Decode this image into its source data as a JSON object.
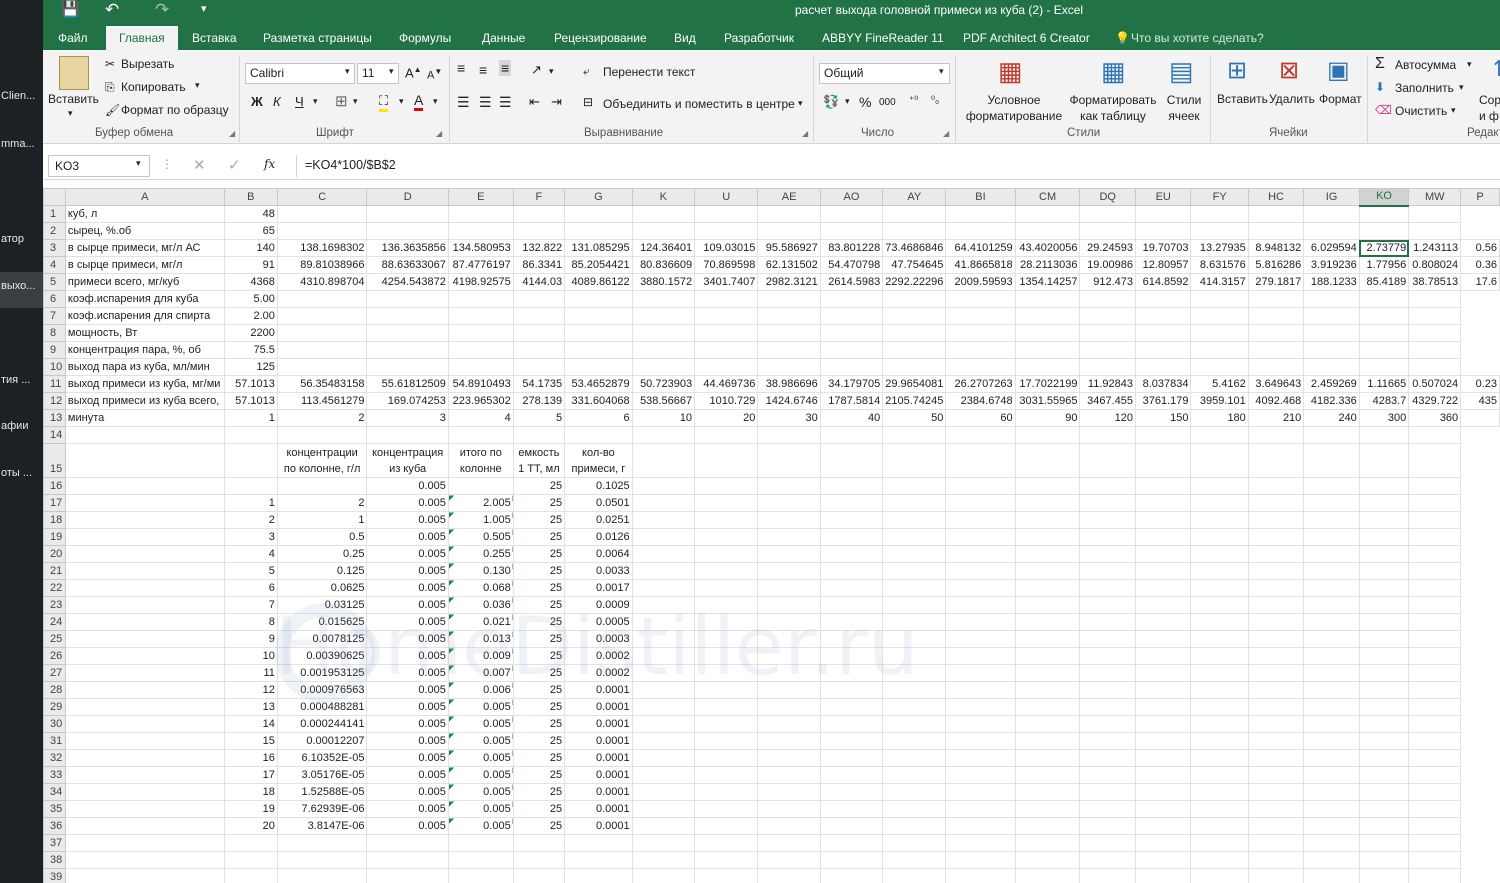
{
  "app": {
    "window_title": "расчет выхода головной примеси из куба (2) - Excel",
    "quick_access": {
      "save": "💾",
      "undo": "↶",
      "redo": "↷",
      "more": "▾"
    }
  },
  "left_panel": [
    "Clien...",
    "mma...",
    "атор",
    "выхо...",
    "тия ...",
    "афии",
    "оты ..."
  ],
  "tabs": [
    "Файл",
    "Главная",
    "Вставка",
    "Разметка страницы",
    "Формулы",
    "Данные",
    "Рецензирование",
    "Вид",
    "Разработчик",
    "ABBYY FineReader 11",
    "PDF Architect 6 Creator",
    "Что вы хотите сделать?"
  ],
  "ribbon": {
    "clipboard": {
      "paste": "Вставить",
      "cut": "Вырезать",
      "copy": "Копировать",
      "format_painter": "Формат по образцу",
      "group": "Буфер обмена"
    },
    "font": {
      "name": "Calibri",
      "size": "11",
      "bold": "Ж",
      "italic": "К",
      "underline": "Ч",
      "group": "Шрифт"
    },
    "alignment": {
      "wrap": "Перенести текст",
      "merge": "Объединить и поместить в центре",
      "group": "Выравнивание"
    },
    "number": {
      "format": "Общий",
      "group": "Число"
    },
    "styles": {
      "conditional": "Условное форматирование",
      "as_table": "Форматировать как таблицу",
      "cell_styles": "Стили ячеек",
      "group": "Стили"
    },
    "cells": {
      "insert": "Вставить",
      "delete": "Удалить",
      "format": "Формат",
      "group": "Ячейки"
    },
    "editing": {
      "autosum": "Автосумма",
      "fill": "Заполнить",
      "clear": "Очистить",
      "sort": "Сорт",
      "sort2": "и ф",
      "group": "Редактир"
    }
  },
  "formula_bar": {
    "name_box": "KO3",
    "formula": "=KO4*100/$B$2",
    "fx": "fx"
  },
  "columns": [
    "",
    "A",
    "B",
    "C",
    "D",
    "E",
    "F",
    "G",
    "K",
    "U",
    "AE",
    "AO",
    "AY",
    "BI",
    "CM",
    "DQ",
    "EU",
    "FY",
    "HC",
    "IG",
    "KO",
    "MW",
    "P"
  ],
  "rows": [
    {
      "n": "1",
      "cells": [
        "куб, л",
        "48",
        "",
        "",
        "",
        "",
        "",
        "",
        "",
        "",
        "",
        "",
        "",
        "",
        "",
        "",
        "",
        "",
        "",
        "",
        ""
      ]
    },
    {
      "n": "2",
      "cells": [
        "сырец, %.об",
        "65",
        "",
        "",
        "",
        "",
        "",
        "",
        "",
        "",
        "",
        "",
        "",
        "",
        "",
        "",
        "",
        "",
        "",
        "",
        ""
      ]
    },
    {
      "n": "3",
      "cells": [
        "в сырце примеси, мг/л АС",
        "140",
        "138.1698302",
        "136.3635856",
        "134.580953",
        "132.822",
        "131.085295",
        "124.36401",
        "109.03015",
        "95.586927",
        "83.801228",
        "73.4686846",
        "64.4101259",
        "43.4020056",
        "29.24593",
        "19.70703",
        "13.27935",
        "8.948132",
        "6.029594",
        "2.73779",
        "1.243113",
        "0.56"
      ]
    },
    {
      "n": "4",
      "cells": [
        "в сырце примеси, мг/л",
        "91",
        "89.81038966",
        "88.63633067",
        "87.4776197",
        "86.3341",
        "85.2054421",
        "80.836609",
        "70.869598",
        "62.131502",
        "54.470798",
        "47.754645",
        "41.8665818",
        "28.2113036",
        "19.00986",
        "12.80957",
        "8.631576",
        "5.816286",
        "3.919236",
        "1.77956",
        "0.808024",
        "0.36"
      ]
    },
    {
      "n": "5",
      "cells": [
        "примеси всего, мг/куб",
        "4368",
        "4310.898704",
        "4254.543872",
        "4198.92575",
        "4144.03",
        "4089.86122",
        "3880.1572",
        "3401.7407",
        "2982.3121",
        "2614.5983",
        "2292.22296",
        "2009.59593",
        "1354.14257",
        "912.473",
        "614.8592",
        "414.3157",
        "279.1817",
        "188.1233",
        "85.4189",
        "38.78513",
        "17.6"
      ]
    },
    {
      "n": "6",
      "cells": [
        "коэф.испарения для куба",
        "5.00",
        "",
        "",
        "",
        "",
        "",
        "",
        "",
        "",
        "",
        "",
        "",
        "",
        "",
        "",
        "",
        "",
        "",
        "",
        ""
      ]
    },
    {
      "n": "7",
      "cells": [
        "коэф.испарения для спирта",
        "2.00",
        "",
        "",
        "",
        "",
        "",
        "",
        "",
        "",
        "",
        "",
        "",
        "",
        "",
        "",
        "",
        "",
        "",
        "",
        ""
      ]
    },
    {
      "n": "8",
      "cells": [
        "мощность, Вт",
        "2200",
        "",
        "",
        "",
        "",
        "",
        "",
        "",
        "",
        "",
        "",
        "",
        "",
        "",
        "",
        "",
        "",
        "",
        "",
        ""
      ]
    },
    {
      "n": "9",
      "cells": [
        "концентрация пара, %, об",
        "75.5",
        "",
        "",
        "",
        "",
        "",
        "",
        "",
        "",
        "",
        "",
        "",
        "",
        "",
        "",
        "",
        "",
        "",
        "",
        ""
      ]
    },
    {
      "n": "10",
      "cells": [
        "выход пара из куба, мл/мин",
        "125",
        "",
        "",
        "",
        "",
        "",
        "",
        "",
        "",
        "",
        "",
        "",
        "",
        "",
        "",
        "",
        "",
        "",
        "",
        ""
      ]
    },
    {
      "n": "11",
      "cells": [
        "выход примеси из куба, мг/ми",
        "57.1013",
        "56.35483158",
        "55.61812509",
        "54.8910493",
        "54.1735",
        "53.4652879",
        "50.723903",
        "44.469736",
        "38.986696",
        "34.179705",
        "29.9654081",
        "26.2707263",
        "17.7022199",
        "11.92843",
        "8.037834",
        "5.4162",
        "3.649643",
        "2.459269",
        "1.11665",
        "0.507024",
        "0.23"
      ]
    },
    {
      "n": "12",
      "cells": [
        "выход примеси из куба всего,",
        "57.1013",
        "113.4561279",
        "169.074253",
        "223.965302",
        "278.139",
        "331.604068",
        "538.56667",
        "1010.729",
        "1424.6746",
        "1787.5814",
        "2105.74245",
        "2384.6748",
        "3031.55965",
        "3467.455",
        "3761.179",
        "3959.101",
        "4092.468",
        "4182.336",
        "4283.7",
        "4329.722",
        "435"
      ]
    },
    {
      "n": "13",
      "cells": [
        "минута",
        "1",
        "2",
        "3",
        "4",
        "5",
        "6",
        "10",
        "20",
        "30",
        "40",
        "50",
        "60",
        "90",
        "120",
        "150",
        "180",
        "210",
        "240",
        "300",
        "360",
        ""
      ]
    },
    {
      "n": "14",
      "cells": [
        "",
        "",
        "",
        "",
        "",
        "",
        "",
        "",
        "",
        "",
        "",
        "",
        "",
        "",
        "",
        "",
        "",
        "",
        "",
        "",
        ""
      ]
    }
  ],
  "lower_header": {
    "c": "концентрации по колонне, г/л",
    "d": "концентрация из куба",
    "e": "итого по колонне",
    "f": "емкость 1 ТТ, мл",
    "g": "кол-во примеси, г"
  },
  "lower_rows": [
    {
      "n": "16",
      "b": "",
      "c": "",
      "d": "0.005",
      "e": "",
      "f": "25",
      "g": "0.1025"
    },
    {
      "n": "17",
      "b": "1",
      "c": "2",
      "d": "0.005",
      "e": "2.005",
      "f": "25",
      "g": "0.0501"
    },
    {
      "n": "18",
      "b": "2",
      "c": "1",
      "d": "0.005",
      "e": "1.005",
      "f": "25",
      "g": "0.0251"
    },
    {
      "n": "19",
      "b": "3",
      "c": "0.5",
      "d": "0.005",
      "e": "0.505",
      "f": "25",
      "g": "0.0126"
    },
    {
      "n": "20",
      "b": "4",
      "c": "0.25",
      "d": "0.005",
      "e": "0.255",
      "f": "25",
      "g": "0.0064"
    },
    {
      "n": "21",
      "b": "5",
      "c": "0.125",
      "d": "0.005",
      "e": "0.130",
      "f": "25",
      "g": "0.0033"
    },
    {
      "n": "22",
      "b": "6",
      "c": "0.0625",
      "d": "0.005",
      "e": "0.068",
      "f": "25",
      "g": "0.0017"
    },
    {
      "n": "23",
      "b": "7",
      "c": "0.03125",
      "d": "0.005",
      "e": "0.036",
      "f": "25",
      "g": "0.0009"
    },
    {
      "n": "24",
      "b": "8",
      "c": "0.015625",
      "d": "0.005",
      "e": "0.021",
      "f": "25",
      "g": "0.0005"
    },
    {
      "n": "25",
      "b": "9",
      "c": "0.0078125",
      "d": "0.005",
      "e": "0.013",
      "f": "25",
      "g": "0.0003"
    },
    {
      "n": "26",
      "b": "10",
      "c": "0.00390625",
      "d": "0.005",
      "e": "0.009",
      "f": "25",
      "g": "0.0002"
    },
    {
      "n": "27",
      "b": "11",
      "c": "0.001953125",
      "d": "0.005",
      "e": "0.007",
      "f": "25",
      "g": "0.0002"
    },
    {
      "n": "28",
      "b": "12",
      "c": "0.000976563",
      "d": "0.005",
      "e": "0.006",
      "f": "25",
      "g": "0.0001"
    },
    {
      "n": "29",
      "b": "13",
      "c": "0.000488281",
      "d": "0.005",
      "e": "0.005",
      "f": "25",
      "g": "0.0001"
    },
    {
      "n": "30",
      "b": "14",
      "c": "0.000244141",
      "d": "0.005",
      "e": "0.005",
      "f": "25",
      "g": "0.0001"
    },
    {
      "n": "31",
      "b": "15",
      "c": "0.00012207",
      "d": "0.005",
      "e": "0.005",
      "f": "25",
      "g": "0.0001"
    },
    {
      "n": "32",
      "b": "16",
      "c": "6.10352E-05",
      "d": "0.005",
      "e": "0.005",
      "f": "25",
      "g": "0.0001"
    },
    {
      "n": "33",
      "b": "17",
      "c": "3.05176E-05",
      "d": "0.005",
      "e": "0.005",
      "f": "25",
      "g": "0.0001"
    },
    {
      "n": "34",
      "b": "18",
      "c": "1.52588E-05",
      "d": "0.005",
      "e": "0.005",
      "f": "25",
      "g": "0.0001"
    },
    {
      "n": "35",
      "b": "19",
      "c": "7.62939E-06",
      "d": "0.005",
      "e": "0.005",
      "f": "25",
      "g": "0.0001"
    },
    {
      "n": "36",
      "b": "20",
      "c": "3.8147E-06",
      "d": "0.005",
      "e": "0.005",
      "f": "25",
      "g": "0.0001"
    }
  ],
  "empty_rows": [
    "37",
    "38",
    "39"
  ],
  "watermark": "HomeDistiller.ru"
}
